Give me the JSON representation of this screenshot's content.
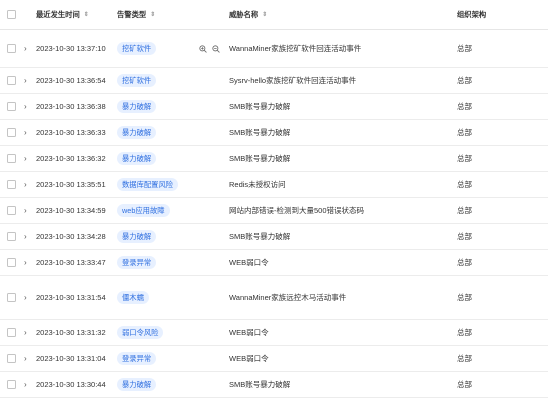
{
  "header": {
    "time_label": "最近发生时间",
    "type_label": "告警类型",
    "name_label": "威胁名称",
    "org_label": "组织架构"
  },
  "icons": {
    "expand": "›",
    "sort": "⇕",
    "zoom_in": "zoom-in-icon",
    "zoom_out": "zoom-out-icon"
  },
  "colors": {
    "tag_bg": "#e7f0ff",
    "tag_text": "#2f6fe0"
  },
  "rows": [
    {
      "time": "2023-10-30 13:37:10",
      "type": "挖矿软件",
      "name": "WannaMiner家族挖矿软件回连活动事件",
      "org": "总部"
    },
    {
      "time": "2023-10-30 13:36:54",
      "type": "挖矿软件",
      "name": "Sysrv-hello家族挖矿软件回连活动事件",
      "org": "总部"
    },
    {
      "time": "2023-10-30 13:36:38",
      "type": "暴力破解",
      "name": "SMB账号暴力破解",
      "org": "总部"
    },
    {
      "time": "2023-10-30 13:36:33",
      "type": "暴力破解",
      "name": "SMB账号暴力破解",
      "org": "总部"
    },
    {
      "time": "2023-10-30 13:36:32",
      "type": "暴力破解",
      "name": "SMB账号暴力破解",
      "org": "总部"
    },
    {
      "time": "2023-10-30 13:35:51",
      "type": "数据库配置风险",
      "name": "Redis未授权访问",
      "org": "总部"
    },
    {
      "time": "2023-10-30 13:34:59",
      "type": "web应用故障",
      "name": "网站内部错误-检测到大量500错误状态码",
      "org": "总部"
    },
    {
      "time": "2023-10-30 13:34:28",
      "type": "暴力破解",
      "name": "SMB账号暴力破解",
      "org": "总部"
    },
    {
      "time": "2023-10-30 13:33:47",
      "type": "登录异常",
      "name": "WEB弱口令",
      "org": "总部"
    },
    {
      "time": "2023-10-30 13:31:54",
      "type": "僵木蠕",
      "name": "WannaMiner家族远控木马活动事件",
      "org": "总部"
    },
    {
      "time": "2023-10-30 13:31:32",
      "type": "弱口令风险",
      "name": "WEB弱口令",
      "org": "总部"
    },
    {
      "time": "2023-10-30 13:31:04",
      "type": "登录异常",
      "name": "WEB弱口令",
      "org": "总部"
    },
    {
      "time": "2023-10-30 13:30:44",
      "type": "暴力破解",
      "name": "SMB账号暴力破解",
      "org": "总部"
    }
  ]
}
